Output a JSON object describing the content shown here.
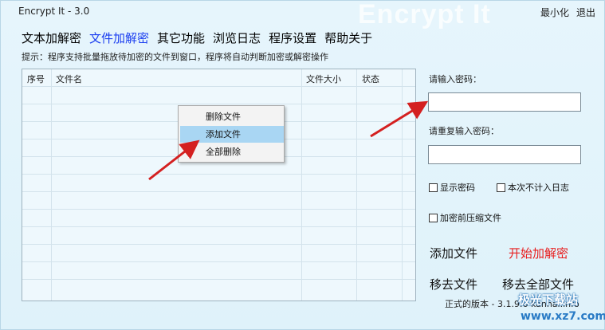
{
  "window": {
    "title": "Encrypt It - 3.0",
    "watermark": "Encrypt It",
    "minimize_label": "最小化",
    "close_label": "退出"
  },
  "nav": {
    "items": [
      {
        "label": "文本加解密",
        "active": false
      },
      {
        "label": "文件加解密",
        "active": true
      },
      {
        "label": "其它功能",
        "active": false
      },
      {
        "label": "浏览日志",
        "active": false
      },
      {
        "label": "程序设置",
        "active": false
      },
      {
        "label": "帮助关于",
        "active": false
      }
    ]
  },
  "hint": "提示：程序支持批量拖放待加密的文件到窗口，程序将自动判断加密或解密操作",
  "table": {
    "columns": [
      "序号",
      "文件名",
      "文件大小",
      "状态"
    ]
  },
  "context_menu": {
    "items": [
      {
        "label": "删除文件",
        "highlighted": false
      },
      {
        "label": "添加文件",
        "highlighted": true
      },
      {
        "label": "全部删除",
        "highlighted": false
      }
    ]
  },
  "password": {
    "label": "请输入密码：",
    "value": "",
    "confirm_label": "请重复输入密码：",
    "confirm_value": ""
  },
  "options": {
    "show_password": "显示密码",
    "no_log": "本次不计入日志",
    "compress": "加密前压缩文件"
  },
  "actions": {
    "add_file": "添加文件",
    "start": "开始加解密",
    "remove_file": "移去文件",
    "remove_all": "移去全部文件"
  },
  "version_text": "正式的版本 - 3.1.9.6 kanhai.info",
  "site": {
    "logo_text": "极光下载站",
    "url": "www.xz7.com"
  },
  "colors": {
    "active_nav": "#1a3df0",
    "start_button": "#e81d1d",
    "arrow": "#d42020",
    "menu_highlight": "#a9d6f3"
  }
}
